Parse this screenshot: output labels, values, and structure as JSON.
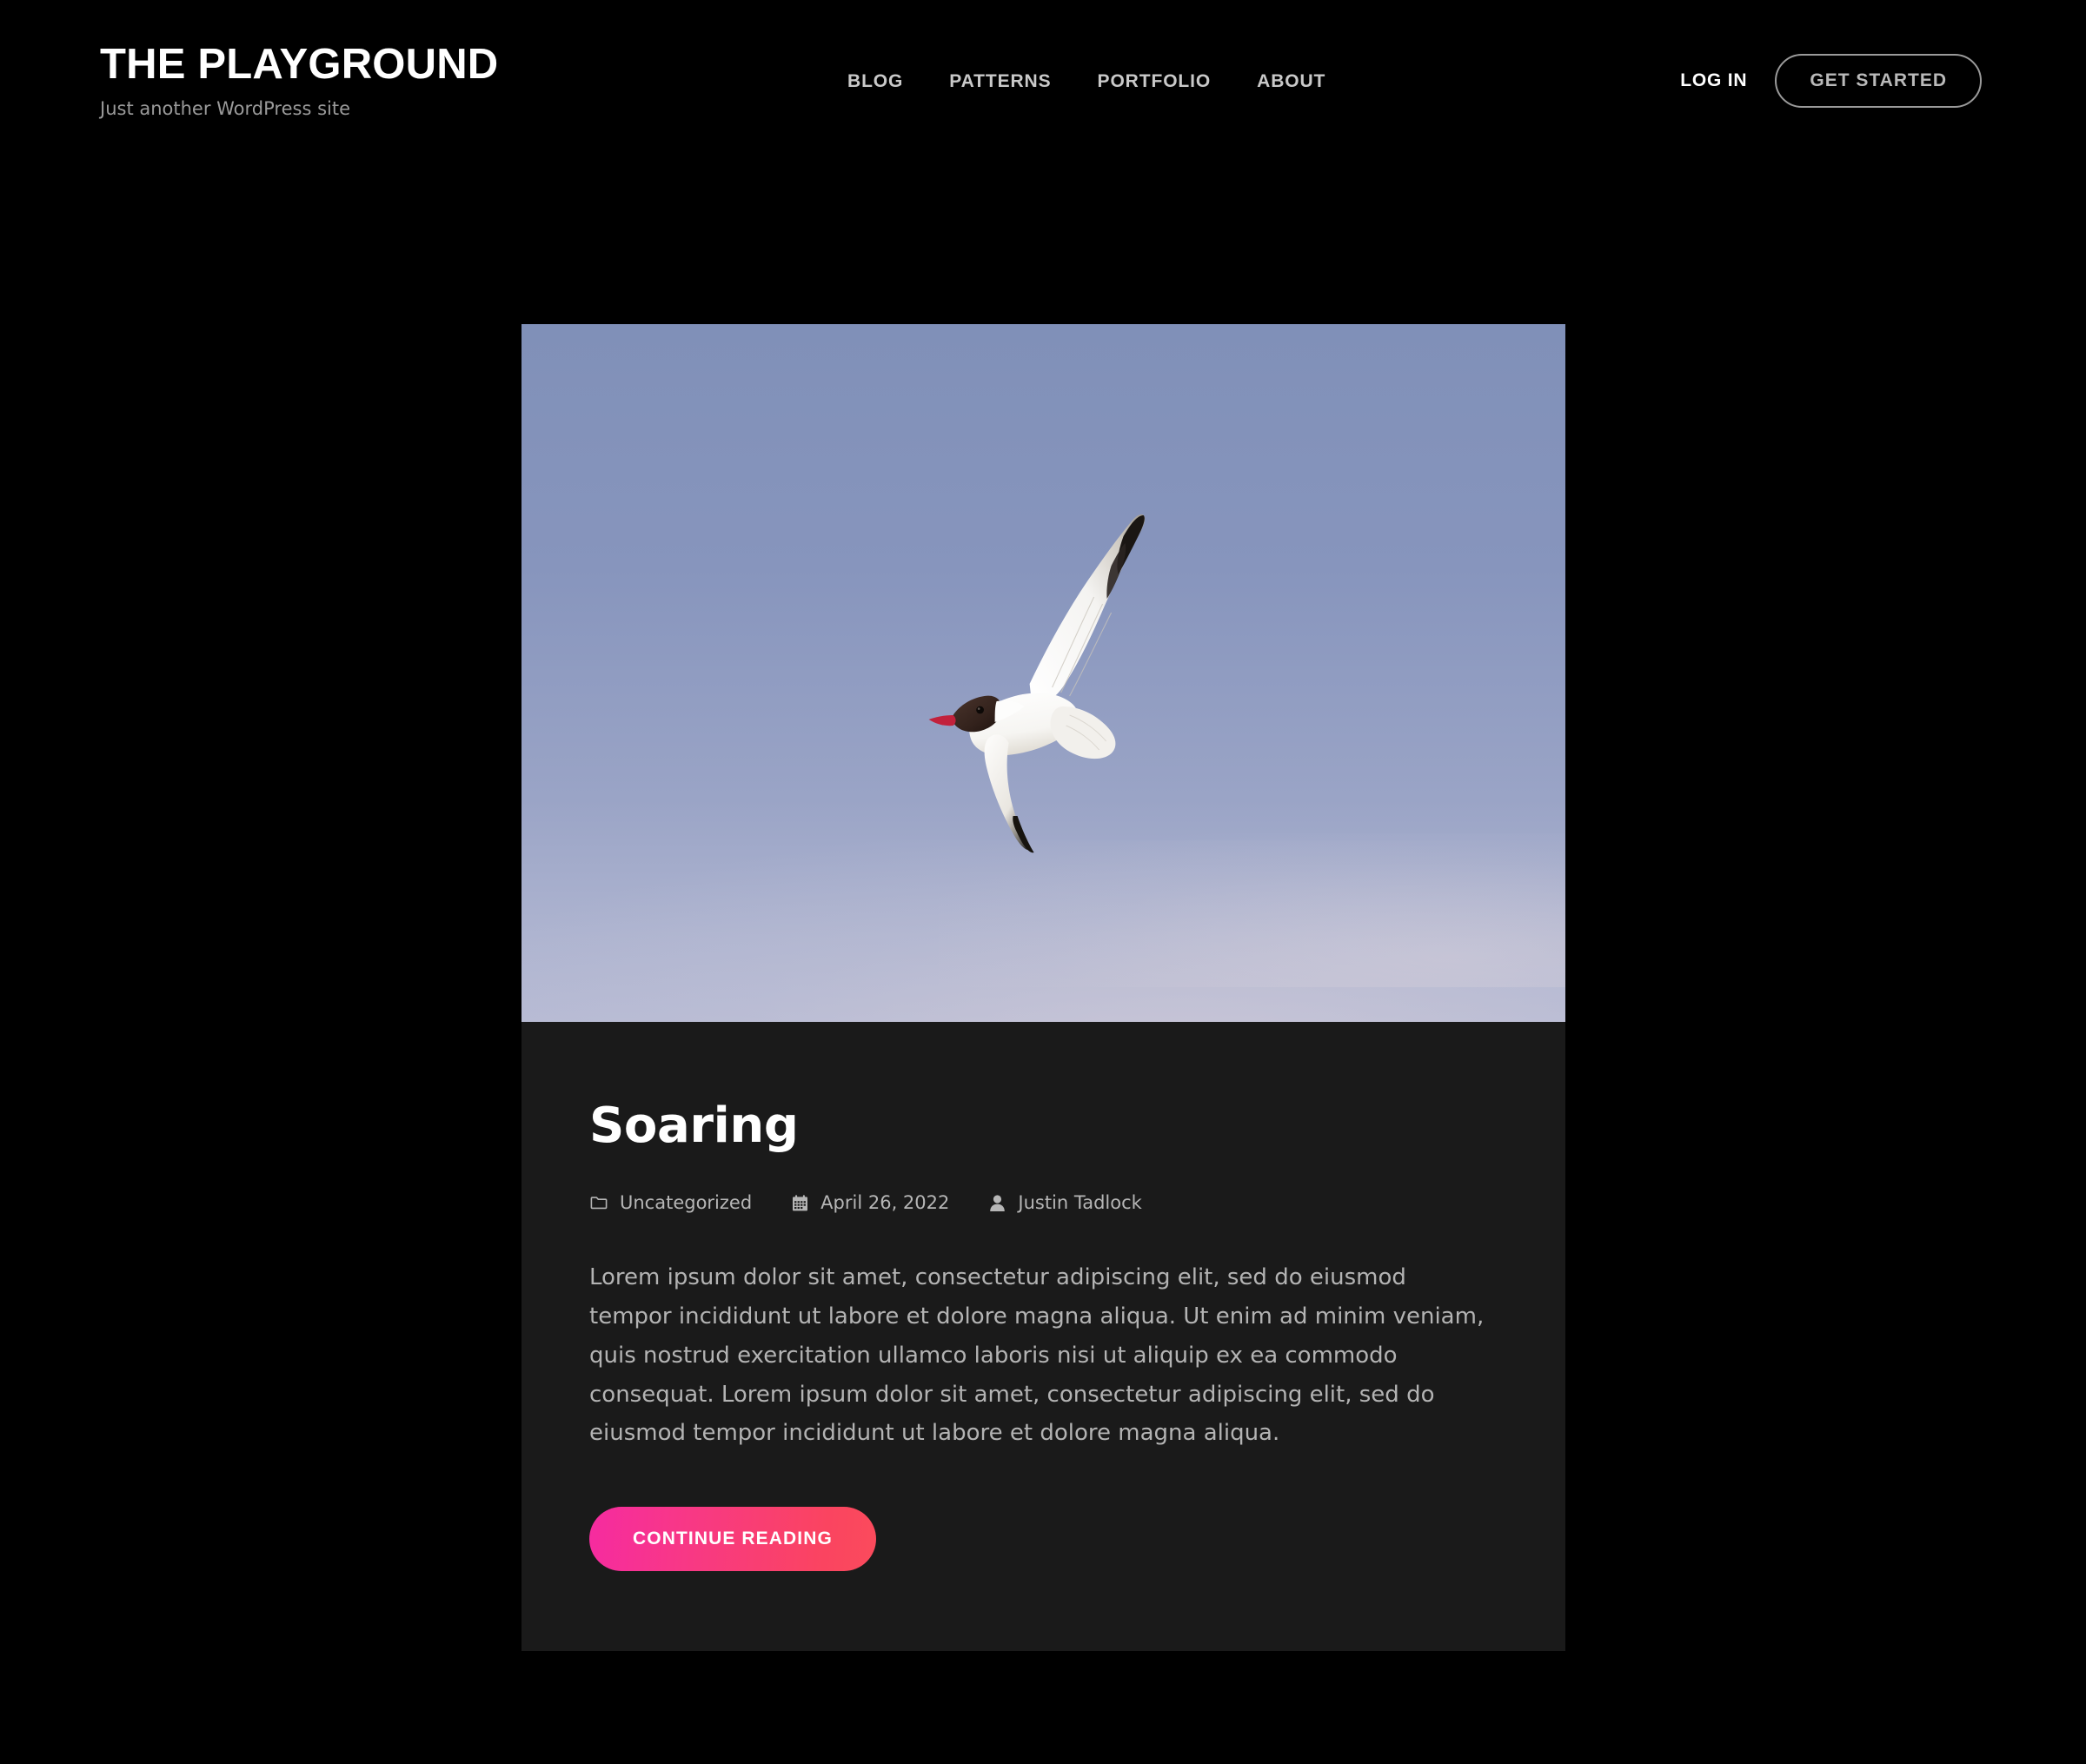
{
  "header": {
    "site_title": "THE PLAYGROUND",
    "tagline": "Just another WordPress site",
    "nav": [
      {
        "label": "BLOG"
      },
      {
        "label": "PATTERNS"
      },
      {
        "label": "PORTFOLIO"
      },
      {
        "label": "ABOUT"
      }
    ],
    "login_label": "LOG IN",
    "get_started_label": "GET STARTED"
  },
  "post": {
    "featured_image_alt": "A black-headed gull soaring against a blue sky",
    "title": "Soaring",
    "meta": {
      "category_icon": "folder-icon",
      "category": "Uncategorized",
      "date_icon": "calendar-icon",
      "date": "April 26, 2022",
      "author_icon": "user-icon",
      "author": "Justin Tadlock"
    },
    "excerpt": "Lorem ipsum dolor sit amet, consectetur adipiscing elit, sed do eiusmod tempor incididunt ut labore et dolore magna aliqua. Ut enim ad minim veniam, quis nostrud exercitation ullamco laboris nisi ut aliquip ex ea commodo consequat. Lorem ipsum dolor sit amet, consectetur adipiscing elit, sed do eiusmod tempor incididunt ut labore et dolore magna aliqua.",
    "continue_label": "CONTINUE READING"
  },
  "colors": {
    "page_background": "#000000",
    "card_background": "#1a1a1a",
    "accent_gradient_start": "#f62ba0",
    "accent_gradient_end": "#fa4b5e",
    "nav_text": "#c9c9c9",
    "body_text": "#b3b3b3",
    "sky_top": "#8090b8",
    "sky_bottom": "#b6bad4"
  }
}
